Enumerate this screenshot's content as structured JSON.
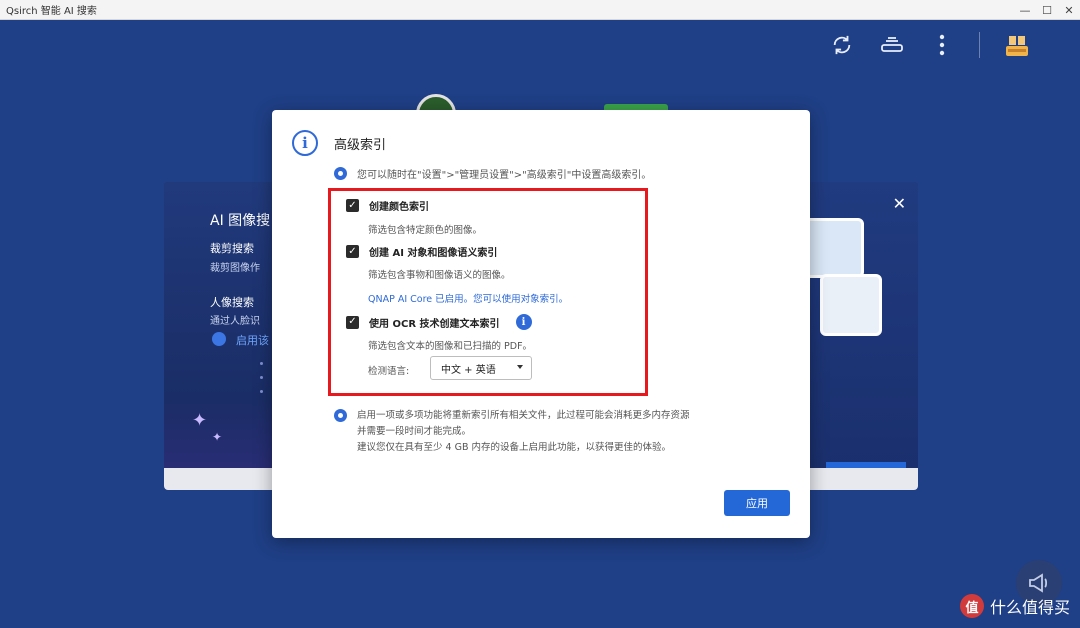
{
  "window": {
    "title": "Qsirch 智能 AI 搜索",
    "controls": {
      "minimize": "—",
      "maximize": "☐",
      "close": "✕"
    }
  },
  "toolbar": {
    "icons": [
      "refresh-icon",
      "drive-icon",
      "more-vert-icon",
      "user-avatar-icon"
    ]
  },
  "background_panel": {
    "heading": "AI 图像搜",
    "item1_title": "裁剪搜索",
    "item1_desc": "裁剪图像作",
    "item2_title": "人像搜索",
    "item2_desc": "通过人脸识",
    "link": "启用该",
    "close": "✕"
  },
  "dialog": {
    "title": "高级索引",
    "hint": "您可以随时在\"设置\">\"管理员设置\">\"高级索引\"中设置高级索引。",
    "options": [
      {
        "label": "创建颜色索引",
        "desc": "筛选包含特定颜色的图像。",
        "checked": true
      },
      {
        "label": "创建 AI 对象和图像语义索引",
        "desc": "筛选包含事物和图像语义的图像。",
        "checked": true
      },
      {
        "label": "使用 OCR 技术创建文本索引",
        "desc": "筛选包含文本的图像和已扫描的 PDF。",
        "checked": true
      }
    ],
    "core_note": "QNAP AI Core 已启用。您可以使用对象索引。",
    "language_label": "检测语言:",
    "language_value": "中文 + 英语",
    "notice_line1": "启用一项或多项功能将重新索引所有相关文件，此过程可能会消耗更多内存资源",
    "notice_line2": "并需要一段时间才能完成。",
    "notice_line3": "建议您仅在具有至少 4 GB 内存的设备上启用此功能，以获得更佳的体验。",
    "apply_label": "应用"
  },
  "watermark": {
    "badge": "值",
    "text": "什么值得买"
  },
  "colors": {
    "accent": "#2468d8",
    "highlight": "#e5191e",
    "background": "#1f3f86"
  }
}
